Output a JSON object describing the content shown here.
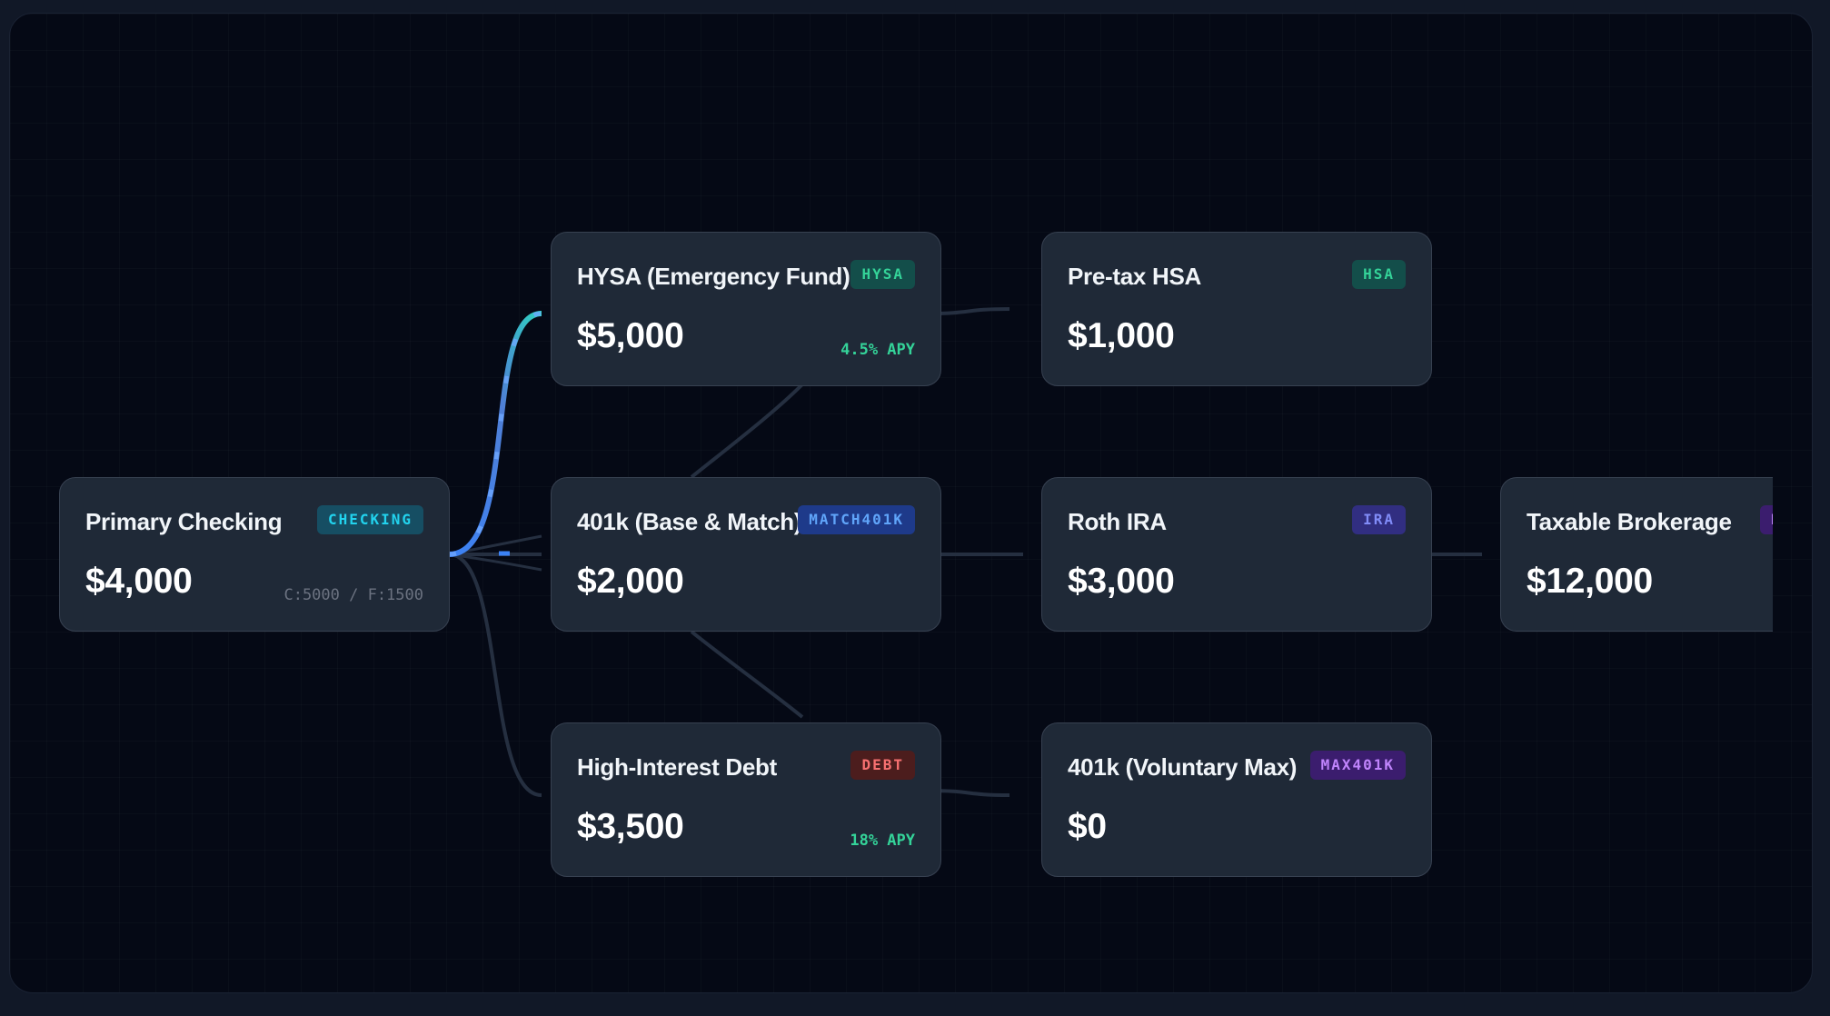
{
  "nodes": {
    "checking": {
      "name": "Primary Checking",
      "amount": "$4,000",
      "badge": "CHECKING",
      "meta": "C:5000 / F:1500"
    },
    "hysa": {
      "name": "HYSA (Emergency Fund)",
      "amount": "$5,000",
      "badge": "HYSA",
      "meta": "4.5% APY"
    },
    "match401k": {
      "name": "401k (Base & Match)",
      "amount": "$2,000",
      "badge": "MATCH401K"
    },
    "debt": {
      "name": "High-Interest Debt",
      "amount": "$3,500",
      "badge": "DEBT",
      "meta": "18% APY"
    },
    "hsa": {
      "name": "Pre-tax HSA",
      "amount": "$1,000",
      "badge": "HSA"
    },
    "ira": {
      "name": "Roth IRA",
      "amount": "$3,000",
      "badge": "IRA"
    },
    "max401k": {
      "name": "401k (Voluntary Max)",
      "amount": "$0",
      "badge": "MAX401K"
    },
    "brokerage": {
      "name": "Taxable Brokerage",
      "amount": "$12,000",
      "badge": "BROKERAGE"
    }
  },
  "edges": [
    {
      "from": "Primary Checking",
      "to": "HYSA (Emergency Fund)",
      "active": true
    },
    {
      "from": "Primary Checking",
      "to": "401k (Base & Match)",
      "active": false
    },
    {
      "from": "Primary Checking",
      "to": "High-Interest Debt",
      "active": false
    },
    {
      "from": "HYSA (Emergency Fund)",
      "to": "Pre-tax HSA",
      "active": false
    },
    {
      "from": "HYSA (Emergency Fund)",
      "to": "401k (Base & Match)",
      "active": false
    },
    {
      "from": "401k (Base & Match)",
      "to": "Roth IRA",
      "active": false
    },
    {
      "from": "401k (Base & Match)",
      "to": "High-Interest Debt",
      "active": false
    },
    {
      "from": "High-Interest Debt",
      "to": "401k (Voluntary Max)",
      "active": false
    },
    {
      "from": "Roth IRA",
      "to": "Taxable Brokerage",
      "active": false
    }
  ],
  "colors": {
    "canvas": "#050915",
    "node": "#1f2937",
    "edge": "#252f40",
    "active_edge_start": "#3b82f6",
    "active_edge_end": "#2dd4bf"
  }
}
